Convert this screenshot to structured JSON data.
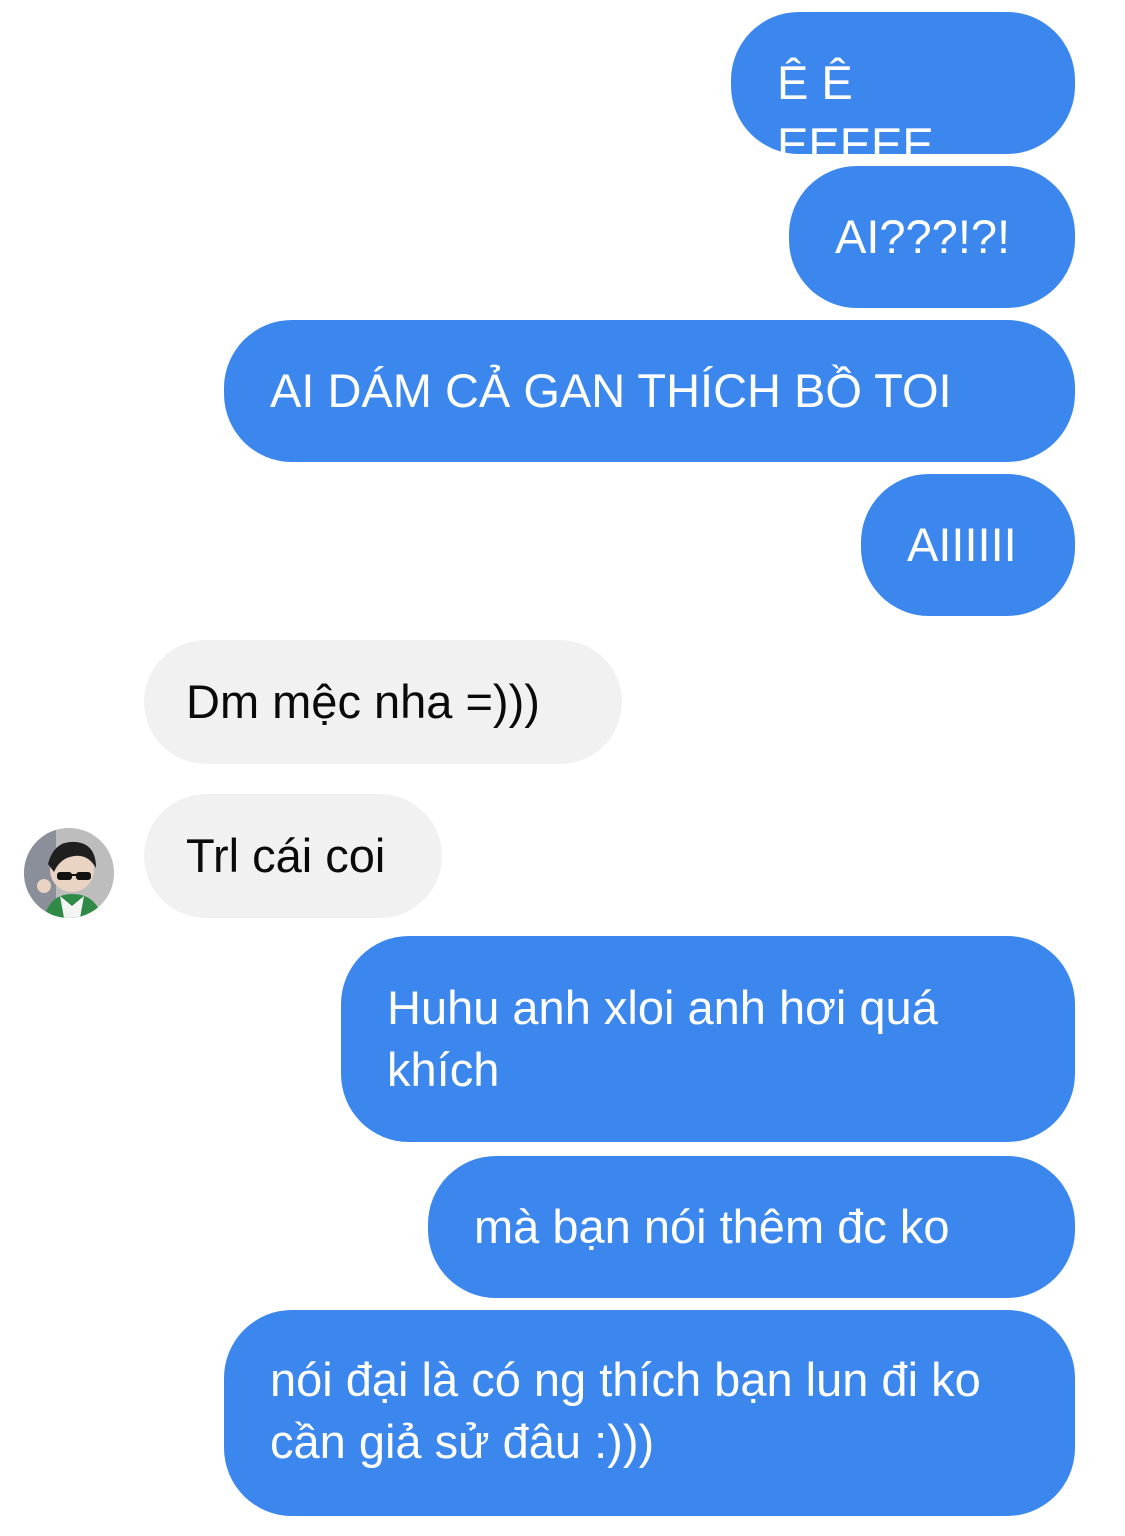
{
  "messages": [
    {
      "side": "out",
      "text": "Ê Ê EEEEE"
    },
    {
      "side": "out",
      "text": "AI???!?!"
    },
    {
      "side": "out",
      "text": "AI DÁM CẢ GAN THÍCH BỒ TOI"
    },
    {
      "side": "out",
      "text": "AIIIIII"
    },
    {
      "side": "in",
      "text": "Dm mệc nha =)))"
    },
    {
      "side": "in",
      "text": "Trl cái coi"
    },
    {
      "side": "out",
      "text": "Huhu anh xloi anh hơi quá khích"
    },
    {
      "side": "out",
      "text": "mà bạn nói thêm đc ko"
    },
    {
      "side": "out",
      "text": "nói đại là có ng thích bạn lun đi ko cần giả sử đâu :)))"
    }
  ],
  "contact": {
    "avatar_icon": "contact-avatar"
  },
  "colors": {
    "outgoing_bubble": "#3b87ee",
    "incoming_bubble": "#f1f1f1",
    "outgoing_text": "#ffffff",
    "incoming_text": "#0a0a0a"
  }
}
